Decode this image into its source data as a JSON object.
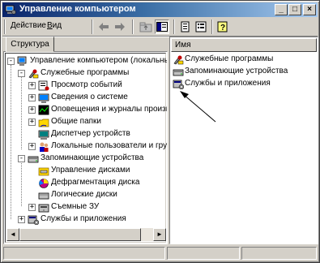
{
  "window": {
    "title": "Управление компьютером",
    "controls": {
      "minimize": "_",
      "maximize": "□",
      "close": "×"
    }
  },
  "menubar": {
    "items": [
      {
        "label": "Действие",
        "underline": "Д",
        "rest": "ействие"
      },
      {
        "label": "Вид",
        "underline": "В",
        "rest": "ид"
      }
    ],
    "toolbar_icons": [
      "back-arrow-icon",
      "forward-arrow-icon",
      "up-folder-icon",
      "show-tree-icon",
      "export-list-icon",
      "properties-icon",
      "help-icon"
    ]
  },
  "left_pane": {
    "tab_label": "Структура",
    "tree": [
      {
        "label": "Управление компьютером (локальным)",
        "expander": "-",
        "icon": "computer-management-icon",
        "level": 0
      },
      {
        "label": "Служебные программы",
        "expander": "-",
        "icon": "system-tools-icon",
        "level": 1
      },
      {
        "label": "Просмотр событий",
        "expander": "+",
        "icon": "event-viewer-icon",
        "level": 2
      },
      {
        "label": "Сведения о системе",
        "expander": "+",
        "icon": "system-info-icon",
        "level": 2
      },
      {
        "label": "Оповещения и журналы производительности",
        "expander": "+",
        "icon": "performance-logs-icon",
        "level": 2
      },
      {
        "label": "Общие папки",
        "expander": "+",
        "icon": "shared-folders-icon",
        "level": 2
      },
      {
        "label": "Диспетчер устройств",
        "expander": "",
        "icon": "device-manager-icon",
        "level": 2
      },
      {
        "label": "Локальные пользователи и группы",
        "expander": "+",
        "icon": "local-users-icon",
        "level": 2
      },
      {
        "label": "Запоминающие устройства",
        "expander": "-",
        "icon": "storage-icon",
        "level": 1
      },
      {
        "label": "Управление дисками",
        "expander": "",
        "icon": "disk-management-icon",
        "level": 2
      },
      {
        "label": "Дефрагментация диска",
        "expander": "",
        "icon": "defrag-icon",
        "level": 2
      },
      {
        "label": "Логические диски",
        "expander": "",
        "icon": "logical-drives-icon",
        "level": 2
      },
      {
        "label": "Съемные ЗУ",
        "expander": "+",
        "icon": "removable-storage-icon",
        "level": 2
      },
      {
        "label": "Службы и приложения",
        "expander": "+",
        "icon": "services-apps-icon",
        "level": 1
      }
    ]
  },
  "right_pane": {
    "column_header": "Имя",
    "items": [
      {
        "label": "Служебные программы",
        "icon": "system-tools-icon"
      },
      {
        "label": "Запоминающие устройства",
        "icon": "storage-icon"
      },
      {
        "label": "Службы и приложения",
        "icon": "services-apps-icon"
      }
    ]
  },
  "scrollbar": {
    "left": "◄",
    "right": "►"
  }
}
